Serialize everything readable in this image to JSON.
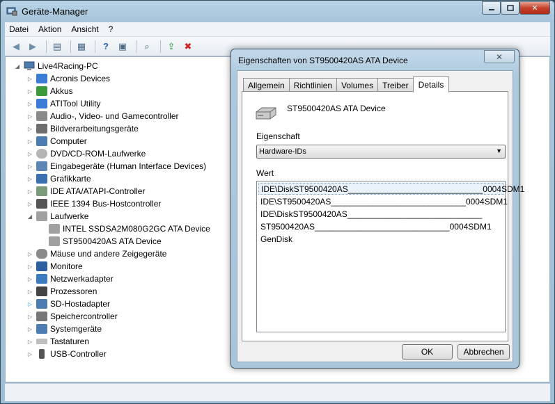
{
  "window": {
    "title": "Geräte-Manager"
  },
  "menu": [
    "Datei",
    "Aktion",
    "Ansicht",
    "?"
  ],
  "tree": {
    "root": "Live4Racing-PC",
    "items": [
      "Acronis Devices",
      "Akkus",
      "ATITool Utility",
      "Audio-, Video- und Gamecontroller",
      "Bildverarbeitungsgeräte",
      "Computer",
      "DVD/CD-ROM-Laufwerke",
      "Eingabegeräte (Human Interface Devices)",
      "Grafikkarte",
      "IDE ATA/ATAPI-Controller",
      "IEEE 1394 Bus-Hostcontroller",
      "Laufwerke",
      "Mäuse und andere Zeigegeräte",
      "Monitore",
      "Netzwerkadapter",
      "Prozessoren",
      "SD-Hostadapter",
      "Speichercontroller",
      "Systemgeräte",
      "Tastaturen",
      "USB-Controller"
    ],
    "drives": [
      "INTEL SSDSA2M080G2GC ATA Device",
      "ST9500420AS ATA Device"
    ]
  },
  "dialog": {
    "title": "Eigenschaften von ST9500420AS ATA Device",
    "tabs": [
      "Allgemein",
      "Richtlinien",
      "Volumes",
      "Treiber",
      "Details"
    ],
    "device_name": "ST9500420AS ATA Device",
    "property_label": "Eigenschaft",
    "property_value": "Hardware-IDs",
    "value_label": "Wert",
    "values": [
      "IDE\\DiskST9500420AS_____________________________0004SDM1",
      "IDE\\ST9500420AS_____________________________0004SDM1",
      "IDE\\DiskST9500420AS_____________________________",
      "ST9500420AS_____________________________0004SDM1",
      "GenDisk"
    ],
    "ok_label": "OK",
    "cancel_label": "Abbrechen"
  },
  "colors": {
    "title_glass": "#a6c4da",
    "close_red": "#c6402a",
    "selection": "#eaf3fc"
  }
}
